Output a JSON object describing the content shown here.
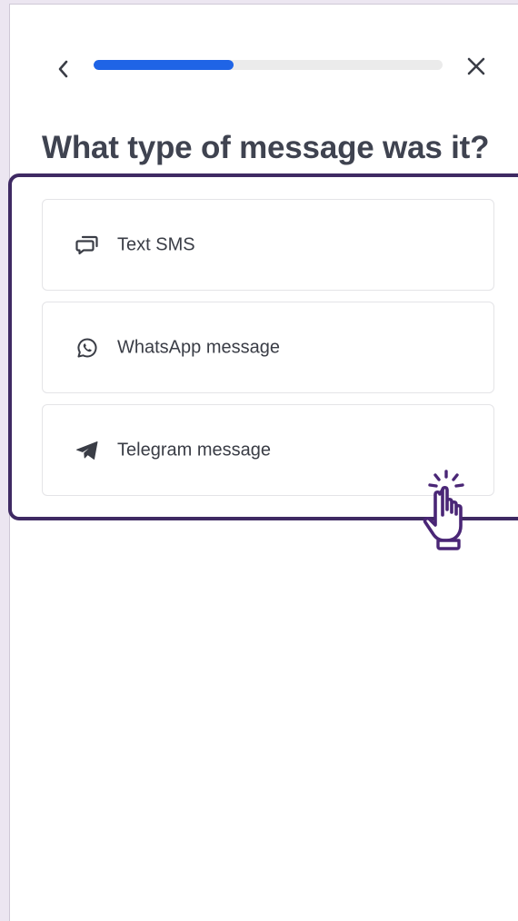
{
  "header": {
    "back_icon": "chevron-left-icon",
    "close_icon": "close-icon",
    "progress_fraction": 0.4
  },
  "title": "What type of message was it?",
  "options": [
    {
      "label": "Text SMS",
      "icon": "chat-bubbles-icon"
    },
    {
      "label": "WhatsApp message",
      "icon": "whatsapp-icon"
    },
    {
      "label": "Telegram message",
      "icon": "telegram-icon"
    }
  ],
  "colors": {
    "accent": "#1f64e6",
    "highlight_border": "#3f2a63",
    "text": "#3f4350"
  },
  "pointer": {
    "icon": "hand-pointer-click-icon"
  }
}
